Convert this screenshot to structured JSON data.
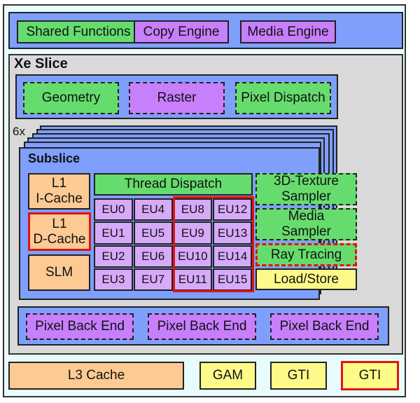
{
  "top_bar": {
    "items": [
      {
        "label": "Shared Functions",
        "color": "#66dc6e"
      },
      {
        "label": "Copy Engine",
        "color": "#c77ffc"
      },
      {
        "label": "Media Engine",
        "color": "#c77ffc"
      }
    ]
  },
  "xe_slice": {
    "title": "Xe Slice",
    "front_end": [
      {
        "label": "Geometry",
        "color": "#66dc6e"
      },
      {
        "label": "Raster",
        "color": "#c77ffc"
      },
      {
        "label": "Pixel Dispatch",
        "color": "#66dc6e"
      }
    ],
    "subslice_count": "6x",
    "subslice": {
      "title": "Subslice",
      "l1_icache": "L1\nI-Cache",
      "l1_dcache": "L1\nD-Cache",
      "slm": "SLM",
      "thread_dispatch": "Thread Dispatch",
      "eus": [
        [
          "EU0",
          "EU4",
          "EU8",
          "EU12"
        ],
        [
          "EU1",
          "EU5",
          "EU9",
          "EU13"
        ],
        [
          "EU2",
          "EU6",
          "EU10",
          "EU14"
        ],
        [
          "EU3",
          "EU7",
          "EU11",
          "EU15"
        ]
      ],
      "texture_sampler": "3D-Texture\nSampler",
      "media_sampler": "Media\nSampler",
      "ray_tracing": "Ray Tracing",
      "load_store": "Load/Store"
    },
    "back_end": [
      "Pixel Back End",
      "Pixel Back End",
      "Pixel Back End"
    ]
  },
  "bottom_bar": {
    "l3_cache": "L3 Cache",
    "gam": "GAM",
    "gti_1": "GTI",
    "gti_2": "GTI"
  },
  "highlight_color": "#e31212"
}
